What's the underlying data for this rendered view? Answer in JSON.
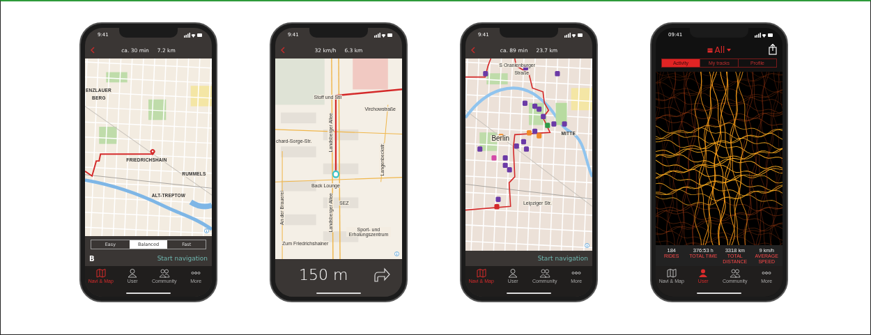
{
  "phones": [
    {
      "kind": "route",
      "status_time": "9:41",
      "header": {
        "stats": [
          "ca. 30 min",
          "7.2 km"
        ]
      },
      "map": {
        "labels": [
          "ENZLAUER",
          "BERG",
          "FRIEDRICHSHAIN",
          "RUMMELS",
          "ALT-TREPTOW"
        ]
      },
      "modes": [
        {
          "label": "Easy",
          "selected": false
        },
        {
          "label": "Balanced",
          "selected": true
        },
        {
          "label": "Fast",
          "selected": false
        }
      ],
      "badge": "B",
      "action": "Start navigation",
      "tabs": [
        {
          "label": "Navi & Map",
          "selected": true
        },
        {
          "label": "User",
          "selected": false
        },
        {
          "label": "Community",
          "selected": false
        },
        {
          "label": "More",
          "selected": false
        }
      ]
    },
    {
      "kind": "navigation",
      "status_time": "9:41",
      "header": {
        "stats": [
          "32 km/h",
          "6.3 km"
        ]
      },
      "map": {
        "labels": [
          "Stoff und Stil",
          "Virchowstraße",
          "chard-Sorge-Str.",
          "Landsberger Allee",
          "Langenbeckstr.",
          "An der Brauerei",
          "Back Lounge",
          "SEZ",
          "Landsberger Allee",
          "Sport- und Erholungszentrum",
          "Zum Friedrichshainer"
        ]
      },
      "distance": "150 m"
    },
    {
      "kind": "pois",
      "status_time": "9:41",
      "header": {
        "stats": [
          "ca. 89 min",
          "23.7 km"
        ]
      },
      "map": {
        "labels": [
          "S Oranienburger",
          "Straße",
          "Berlin",
          "MITTE",
          "Leipziger Str."
        ]
      },
      "action": "Start navigation",
      "tabs": [
        {
          "label": "Navi & Map",
          "selected": true
        },
        {
          "label": "User",
          "selected": false
        },
        {
          "label": "Community",
          "selected": false
        },
        {
          "label": "More",
          "selected": false
        }
      ]
    },
    {
      "kind": "heatmap",
      "status_time": "09:41",
      "header": {
        "title": "All"
      },
      "segments": [
        {
          "label": "Activity",
          "selected": true
        },
        {
          "label": "My tracks",
          "selected": false
        },
        {
          "label": "Profile",
          "selected": false
        }
      ],
      "stats": [
        {
          "value": "184",
          "label": "RIDES"
        },
        {
          "value": "376:53",
          "unit": "h",
          "label": "TOTAL TIME"
        },
        {
          "value": "3318",
          "unit": "km",
          "label": "TOTAL DISTANCE"
        },
        {
          "value": "9",
          "unit": "km/h",
          "label": "AVERAGE SPEED"
        }
      ],
      "tabs": [
        {
          "label": "Navi & Map",
          "selected": false
        },
        {
          "label": "User",
          "selected": true
        },
        {
          "label": "Community",
          "selected": false
        },
        {
          "label": "More",
          "selected": false
        }
      ]
    }
  ]
}
